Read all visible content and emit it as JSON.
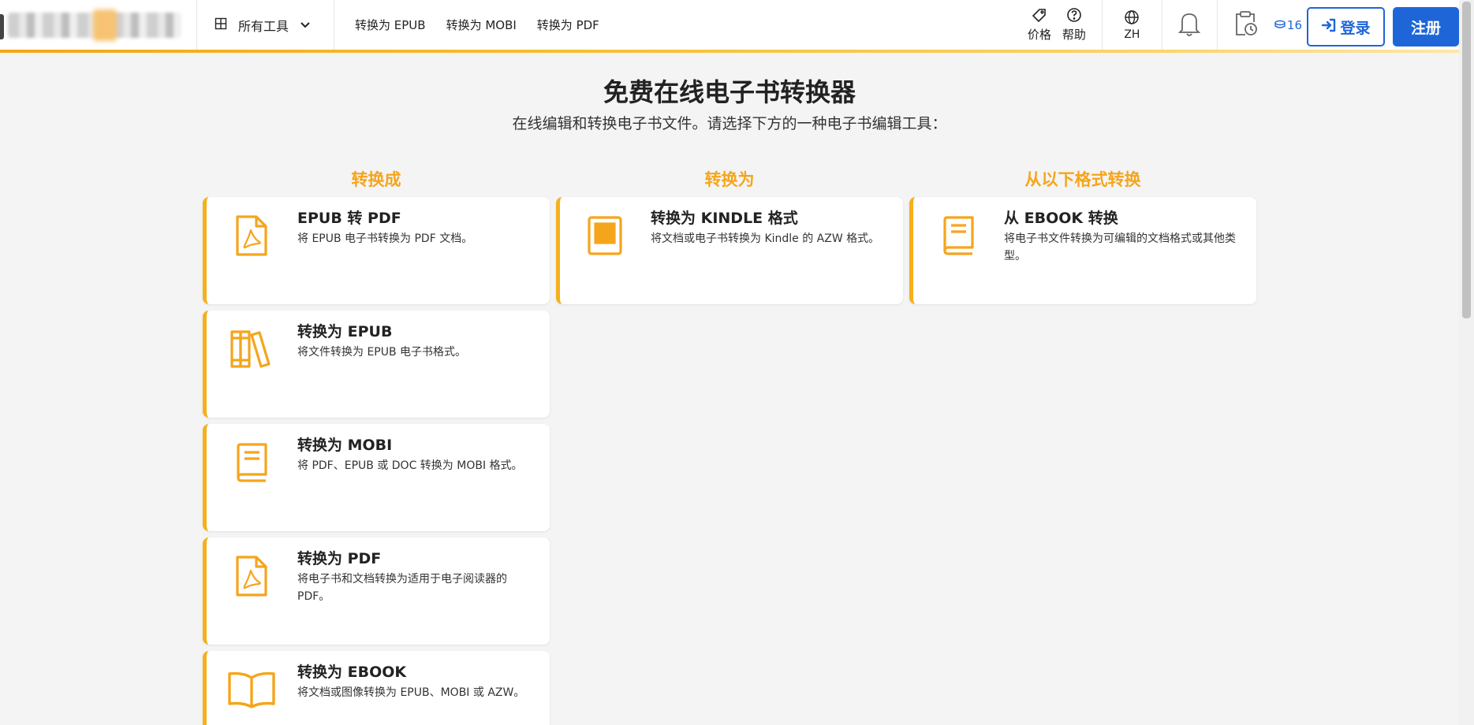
{
  "header": {
    "all_tools": "所有工具",
    "nav": [
      "转换为 EPUB",
      "转换为 MOBI",
      "转换为 PDF"
    ],
    "price": "价格",
    "help": "帮助",
    "lang": "ZH",
    "credits": "16",
    "login": "登录",
    "register": "注册"
  },
  "main": {
    "title": "免费在线电子书转换器",
    "subtitle": "在线编辑和转换电子书文件。请选择下方的一种电子书编辑工具："
  },
  "columns": [
    {
      "heading": "转换成",
      "cards": [
        {
          "title": "EPUB 转 PDF",
          "desc": "将 EPUB 电子书转换为 PDF 文档。",
          "icon": "pdf-file-icon"
        },
        {
          "title": "转换为 EPUB",
          "desc": "将文件转换为 EPUB 电子书格式。",
          "icon": "books-shelf-icon"
        },
        {
          "title": "转换为 MOBI",
          "desc": "将 PDF、EPUB 或 DOC 转换为 MOBI 格式。",
          "icon": "book-icon"
        },
        {
          "title": "转换为 PDF",
          "desc": "将电子书和文档转换为适用于电子阅读器的 PDF。",
          "icon": "pdf-file-icon"
        },
        {
          "title": "转换为 EBOOK",
          "desc": "将文档或图像转换为 EPUB、MOBI 或 AZW。",
          "icon": "open-book-icon"
        }
      ]
    },
    {
      "heading": "转换为",
      "cards": [
        {
          "title": "转换为 KINDLE 格式",
          "desc": "将文档或电子书转换为 Kindle 的 AZW 格式。",
          "icon": "ereader-icon"
        }
      ]
    },
    {
      "heading": "从以下格式转换",
      "cards": [
        {
          "title": "从 EBOOK 转换",
          "desc": "将电子书文件转换为可编辑的文档格式或其他类型。",
          "icon": "book-icon"
        }
      ]
    }
  ],
  "colors": {
    "accent": "#f5a51c",
    "primary": "#1e66d8"
  }
}
